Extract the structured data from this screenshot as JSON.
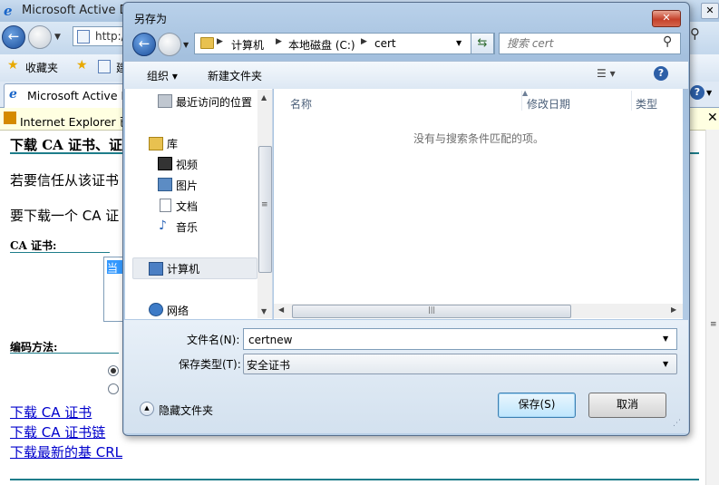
{
  "ie": {
    "title": "Microsoft Active Di",
    "address": "http:/",
    "favorites_label": "收藏夹",
    "fav_item": "建",
    "tab_title": "Microsoft Active D",
    "infobar": "Internet Explorer 已"
  },
  "page": {
    "heading": "下载  CA 证书、证",
    "para1": "若要信任从该证书",
    "para2": "要下载一个  CA 证",
    "ca_label": "CA 证书:",
    "ca_list_selected": "当",
    "encoding_label": "编码方法:",
    "links": [
      "下载  CA 证书",
      "下载  CA 证书链",
      "下载最新的基  CRL"
    ]
  },
  "dialog": {
    "title": "另存为",
    "breadcrumb": [
      "计算机",
      "本地磁盘 (C:)",
      "cert"
    ],
    "search_placeholder": "搜索 cert",
    "toolbar": {
      "organize": "组织 ▾",
      "new_folder": "新建文件夹"
    },
    "nav": {
      "recent": "最近访问的位置",
      "libraries": "库",
      "videos": "视频",
      "pictures": "图片",
      "documents": "文档",
      "music": "音乐",
      "computer": "计算机",
      "network": "网络"
    },
    "columns": {
      "name": "名称",
      "modified": "修改日期",
      "type": "类型"
    },
    "empty_message": "没有与搜索条件匹配的项。",
    "filename_label": "文件名(N):",
    "filename_value": "certnew",
    "filetype_label": "保存类型(T):",
    "filetype_value": "安全证书",
    "hide_folders": "隐藏文件夹",
    "save_button": "保存(S)",
    "cancel_button": "取消"
  }
}
